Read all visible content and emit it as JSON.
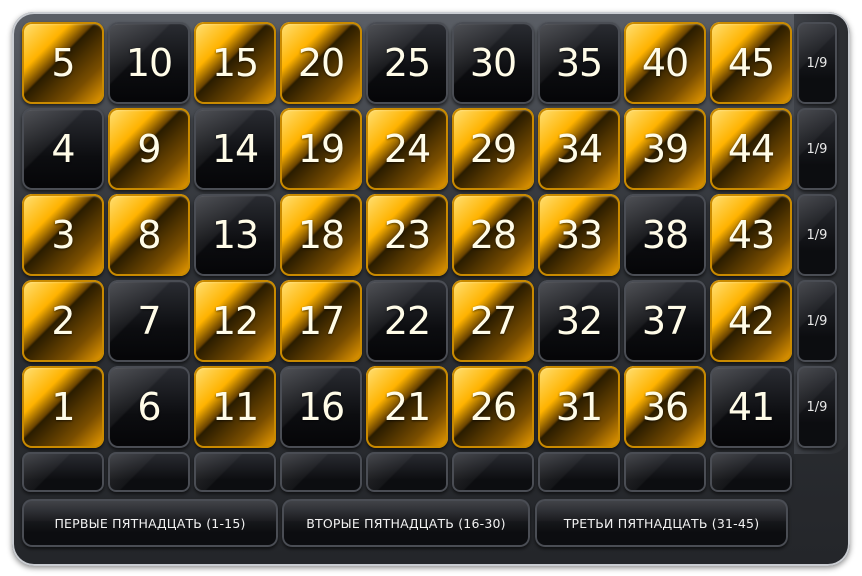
{
  "grid": {
    "columns": [
      [
        {
          "number": "5",
          "state": "gold"
        },
        {
          "number": "4",
          "state": "dark"
        },
        {
          "number": "3",
          "state": "gold"
        },
        {
          "number": "2",
          "state": "gold"
        },
        {
          "number": "1",
          "state": "gold"
        }
      ],
      [
        {
          "number": "10",
          "state": "dark"
        },
        {
          "number": "9",
          "state": "gold"
        },
        {
          "number": "8",
          "state": "gold"
        },
        {
          "number": "7",
          "state": "dark"
        },
        {
          "number": "6",
          "state": "dark"
        }
      ],
      [
        {
          "number": "15",
          "state": "gold"
        },
        {
          "number": "14",
          "state": "dark"
        },
        {
          "number": "13",
          "state": "dark"
        },
        {
          "number": "12",
          "state": "gold"
        },
        {
          "number": "11",
          "state": "gold"
        }
      ],
      [
        {
          "number": "20",
          "state": "gold"
        },
        {
          "number": "19",
          "state": "gold"
        },
        {
          "number": "18",
          "state": "gold"
        },
        {
          "number": "17",
          "state": "gold"
        },
        {
          "number": "16",
          "state": "dark"
        }
      ],
      [
        {
          "number": "25",
          "state": "dark"
        },
        {
          "number": "24",
          "state": "gold"
        },
        {
          "number": "23",
          "state": "gold"
        },
        {
          "number": "22",
          "state": "dark"
        },
        {
          "number": "21",
          "state": "gold"
        }
      ],
      [
        {
          "number": "30",
          "state": "dark"
        },
        {
          "number": "29",
          "state": "gold"
        },
        {
          "number": "28",
          "state": "gold"
        },
        {
          "number": "27",
          "state": "gold"
        },
        {
          "number": "26",
          "state": "gold"
        }
      ],
      [
        {
          "number": "35",
          "state": "dark"
        },
        {
          "number": "34",
          "state": "gold"
        },
        {
          "number": "33",
          "state": "gold"
        },
        {
          "number": "32",
          "state": "dark"
        },
        {
          "number": "31",
          "state": "gold"
        }
      ],
      [
        {
          "number": "40",
          "state": "gold"
        },
        {
          "number": "39",
          "state": "gold"
        },
        {
          "number": "38",
          "state": "dark"
        },
        {
          "number": "37",
          "state": "dark"
        },
        {
          "number": "36",
          "state": "gold"
        }
      ],
      [
        {
          "number": "45",
          "state": "gold"
        },
        {
          "number": "44",
          "state": "gold"
        },
        {
          "number": "43",
          "state": "gold"
        },
        {
          "number": "42",
          "state": "gold"
        },
        {
          "number": "41",
          "state": "dark"
        }
      ]
    ]
  },
  "row_labels": [
    "1/9",
    "1/9",
    "1/9",
    "1/9",
    "1/9"
  ],
  "group_buttons": [
    {
      "label": "ПЕРВЫЕ ПЯТНАДЦАТЬ (1-15)"
    },
    {
      "label": "ВТОРЫЕ ПЯТНАДЦАТЬ (16-30)"
    },
    {
      "label": "ТРЕТЬИ ПЯТНАДЦАТЬ (31-45)"
    }
  ],
  "colors": {
    "selected": "#ffb300",
    "unselected": "#0c0d10",
    "text": "#fffce8"
  }
}
